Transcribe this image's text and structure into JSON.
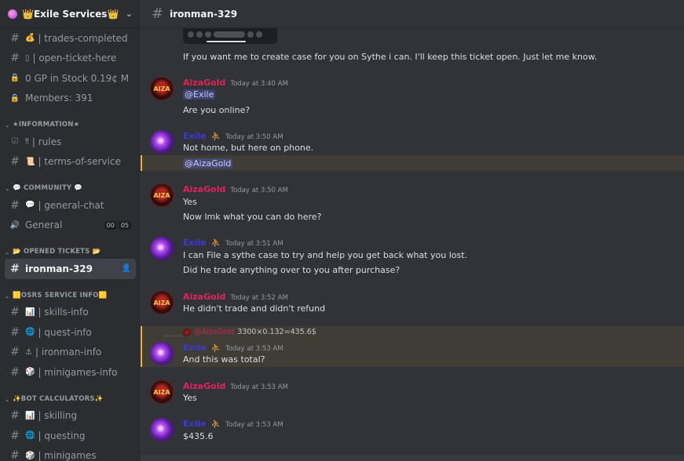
{
  "server": {
    "name": "👑Exile Services👑"
  },
  "channel": {
    "title": "ironman-329"
  },
  "sidebar": {
    "items": [
      {
        "type": "channel",
        "icon": "hash",
        "emoji": "💰",
        "label": "| trades-completed"
      },
      {
        "type": "channel",
        "icon": "hash",
        "emoji": "▯",
        "label": "| open-ticket-here"
      },
      {
        "type": "voice-locked",
        "icon": "lock",
        "label": "0 GP in Stock 0.19¢ M"
      },
      {
        "type": "voice-locked",
        "icon": "lock",
        "label": "Members: 391"
      },
      {
        "type": "category",
        "label": "★INFORMATION★"
      },
      {
        "type": "channel",
        "icon": "checkbox",
        "emoji": "‼",
        "label": "| rules"
      },
      {
        "type": "channel",
        "icon": "hash",
        "emoji": "📜",
        "label": "| terms-of-service"
      },
      {
        "type": "category",
        "label": "💬 COMMUNITY 💬"
      },
      {
        "type": "channel",
        "icon": "hash",
        "emoji": "💬",
        "label": "| general-chat"
      },
      {
        "type": "voice",
        "icon": "speaker",
        "label": "General",
        "badges": [
          "00",
          "05"
        ]
      },
      {
        "type": "category",
        "label": "📂 OPENED TICKETS 📂"
      },
      {
        "type": "channel",
        "icon": "hash",
        "label": "ironman-329",
        "active": true
      },
      {
        "type": "category",
        "label": "🟨OSRS SERVICE INFO🟨"
      },
      {
        "type": "channel",
        "icon": "hash",
        "emoji": "📊",
        "label": "| skills-info"
      },
      {
        "type": "channel",
        "icon": "hash",
        "emoji": "🌐",
        "label": "| quest-info"
      },
      {
        "type": "channel",
        "icon": "hash",
        "emoji": "⚓",
        "label": "| ironman-info"
      },
      {
        "type": "channel",
        "icon": "hash",
        "emoji": "🎲",
        "label": "| minigames-info"
      },
      {
        "type": "category",
        "label": "✨BOT CALCULATORS✨"
      },
      {
        "type": "channel",
        "icon": "hash",
        "emoji": "📊",
        "label": "| skilling"
      },
      {
        "type": "channel",
        "icon": "hash",
        "emoji": "🌐",
        "label": "| questing"
      },
      {
        "type": "channel",
        "icon": "hash",
        "emoji": "🎲",
        "label": "| minigames"
      }
    ]
  },
  "messages": {
    "m0": {
      "text": "If you want me to create case for you on Sythe i can. I'll keep this ticket open. Just let me know."
    },
    "m1": {
      "author": "AizaGold",
      "time": "Today at 3:40 AM",
      "mention": "@Exile",
      "text": "Are you online?"
    },
    "m2": {
      "author": "Exile",
      "time": "Today at 3:50 AM",
      "text": "Not home, but here on phone.",
      "mention": "@AizaGold"
    },
    "m3": {
      "author": "AizaGold",
      "time": "Today at 3:50 AM",
      "text1": "Yes",
      "text2": "Now lmk what you can do here?"
    },
    "m4": {
      "author": "Exile",
      "time": "Today at 3:51 AM",
      "text1": "I can File a sythe case to try and help you get back what you lost.",
      "text2": "Did he trade anything over to you after purchase?"
    },
    "m5": {
      "author": "AizaGold",
      "time": "Today at 3:52 AM",
      "text": "He didn't trade and didn't refund"
    },
    "m6": {
      "reply_name": "@AizaGold",
      "reply_text": "3300×0.132=435.6$",
      "author": "Exile",
      "time": "Today at 3:53 AM",
      "text": "And this was total?"
    },
    "m7": {
      "author": "AizaGold",
      "time": "Today at 3:53 AM",
      "text": "Yes"
    },
    "m8": {
      "author": "Exile",
      "time": "Today at 3:53 AM",
      "text": "$435.6"
    }
  },
  "avatar_labels": {
    "aiza": "AIZA"
  },
  "colors": {
    "aiza_name": "#e0245e",
    "exile_name": "#3a3bd6",
    "active_channel_bg": "#404249",
    "highlight_border": "#f0b132"
  }
}
